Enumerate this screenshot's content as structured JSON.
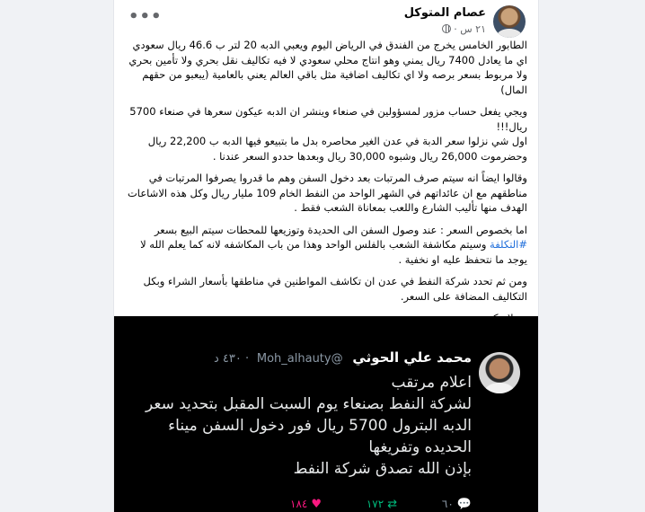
{
  "post": {
    "author": "عصام المتوكل",
    "time": "٢١ س",
    "separator": "·",
    "more_icon": "more-horizontal-icon",
    "paragraphs": [
      "الطابور الخامس يخرج من الفندق في الرياض اليوم ويعبي الدبه 20 لتر ب 46.6 ريال سعودي اي ما يعادل 7400 ريال يمني وهو انتاج محلي سعودي لا فيه تكاليف نقل بحري ولا تأمين بحري ولا مربوط بسعر برصه ولا اي تكاليف اضافية مثل باقي العالم يعني بالعامية (يبعبو من حقهم المال)",
      "ويجي يفعل حساب مزور لمسؤولين في صنعاء وينشر ان الدبه عيكون سعرها في صنعاء 5700 ريال!!!\nاول شي نزلوا سعر الدبة في عدن الغير محاصره بدل ما بتبيعو فيها الدبه ب 22,200 ريال وحضرموت 26,000 ريال وشبوه 30,000 ريال وبعدها حددو السعر عندنا .",
      "وقالوا ايضاً انه سيتم صرف المرتبات بعد دخول السفن وهم ما قدروا يصرفوا المرتبات في مناطقهم مع ان عائداتهم في الشهر الواحد من النفط الخام 109 مليار ريال وكل هذه الاشاعات الهدف منها تأليب الشارع واللعب بمعاناة الشعب فقط .",
      "ومن ثم تحدد شركة النفط في عدن ان تكاشف المواطنين في مناطقها بأسعار الشراء وبكل التكاليف المضافة على السعر.",
      "وسلامتكم"
    ],
    "price_paragraph": {
      "before": "اما بخصوص السعر : عند وصول السفن الى الحديدة وتوزيعها للمحطات سيتم البيع بسعر ",
      "hashtag": "#التكلفة",
      "after": " وسيتم مكاشفة الشعب بالفلس الواحد وهذا من باب المكاشفه لانه كما يعلم الله لا يوجد ما نتحفظ عليه او نخفية ."
    }
  },
  "tweet": {
    "name": "محمد علي الحوثي",
    "handle": "@Moh_alhauty",
    "time": "· ٤٣٠ د",
    "lines": [
      "اعلام مرتقب",
      "لشركة النفط بصنعاء يوم السبت المقبل بتحديد سعر",
      "الدبه البترول 5700 ريال فور دخول السفن ميناء",
      "الحديده وتفريغها",
      "بإذن الله تصدق شركة النفط"
    ],
    "replies": "٦٠",
    "retweets": "١٧٢",
    "likes": "١٨٤"
  }
}
